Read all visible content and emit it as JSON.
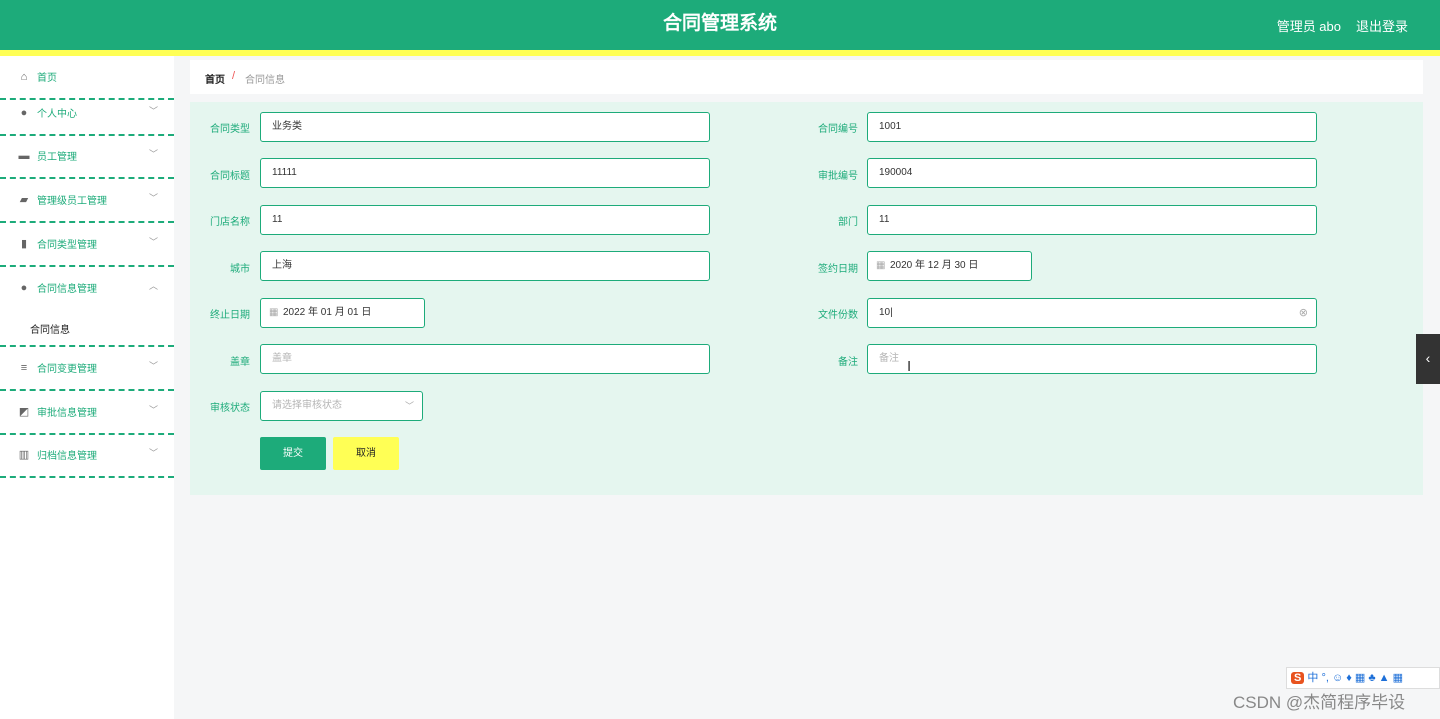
{
  "header": {
    "title": "合同管理系统",
    "user": "管理员 abo",
    "logout": "退出登录"
  },
  "sidebar": {
    "items": [
      {
        "label": "首页",
        "icon": "home-icon"
      },
      {
        "label": "个人中心",
        "icon": "user-icon"
      },
      {
        "label": "员工管理",
        "icon": "briefcase-icon"
      },
      {
        "label": "管理级员工管理",
        "icon": "car-icon"
      },
      {
        "label": "合同类型管理",
        "icon": "bar-chart-icon"
      },
      {
        "label": "合同信息管理",
        "icon": "user-icon"
      },
      {
        "label": "合同变更管理",
        "icon": "list-icon"
      },
      {
        "label": "审批信息管理",
        "icon": "line-chart-icon"
      },
      {
        "label": "归档信息管理",
        "icon": "library-icon"
      }
    ],
    "submenu": {
      "label": "合同信息"
    }
  },
  "breadcrumb": {
    "home": "首页",
    "separator": "/",
    "current": "合同信息"
  },
  "form": {
    "contract_type": {
      "label": "合同类型",
      "value": "业务类"
    },
    "contract_no": {
      "label": "合同编号",
      "value": "1001"
    },
    "contract_title": {
      "label": "合同标题",
      "value": "11111"
    },
    "approval_no": {
      "label": "审批编号",
      "value": "190004"
    },
    "store_name": {
      "label": "门店名称",
      "value": "11"
    },
    "department": {
      "label": "部门",
      "value": "11"
    },
    "city": {
      "label": "城市",
      "value": "上海"
    },
    "sign_date": {
      "label": "签约日期",
      "value": "2020 年 12 月 30 日"
    },
    "end_date": {
      "label": "终止日期",
      "value": "2022 年 01 月 01 日"
    },
    "copies": {
      "label": "文件份数",
      "value": "10"
    },
    "seal": {
      "label": "盖章",
      "placeholder": "盖章"
    },
    "remark": {
      "label": "备注",
      "placeholder": "备注"
    },
    "review_status": {
      "label": "审核状态",
      "placeholder": "请选择审核状态"
    },
    "submit": "提交",
    "cancel": "取消"
  },
  "watermark": "CSDN @杰简程序毕设",
  "colors": {
    "primary": "#1dab7a",
    "accent": "#ffff55",
    "panel": "#e5f6ef"
  }
}
